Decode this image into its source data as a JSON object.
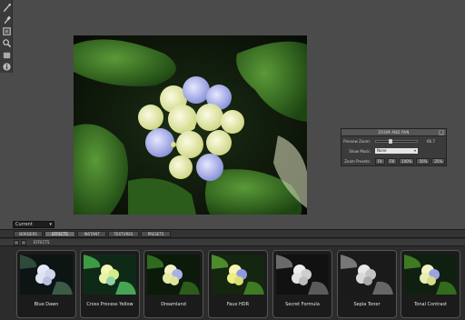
{
  "toolbar": {
    "tools": [
      {
        "name": "brush-icon"
      },
      {
        "name": "eyedropper-icon"
      },
      {
        "name": "layer-icon"
      },
      {
        "name": "zoom-icon"
      },
      {
        "name": "hand-icon"
      },
      {
        "name": "info-icon"
      }
    ]
  },
  "zoom_panel": {
    "title": "ZOOM AND PAN",
    "close_label": "x",
    "preview_zoom_label": "Preview Zoom:",
    "preview_zoom_value": "66.7",
    "show_mask_label": "Show Mask:",
    "show_mask_value": "None",
    "zoom_presets_label": "Zoom Presets:",
    "zoom_presets": [
      "Fit",
      "Fill",
      "100%",
      "50%",
      "25%"
    ]
  },
  "view_select": {
    "value": "Current"
  },
  "tabs": [
    {
      "label": "BORDERS",
      "active": false
    },
    {
      "label": "EFFECTS",
      "active": true
    },
    {
      "label": "INSTANT",
      "active": false
    },
    {
      "label": "TEXTURES",
      "active": false
    },
    {
      "label": "PRESETS",
      "active": false
    }
  ],
  "subbar": {
    "prev": "‹",
    "next": "›",
    "label": "EFFECTS"
  },
  "presets": [
    {
      "label": "Blue Dawn",
      "tone": "blue"
    },
    {
      "label": "Cross Process Yellow",
      "tone": "cross"
    },
    {
      "label": "Dreamland",
      "tone": "dream"
    },
    {
      "label": "Faux HDR",
      "tone": "hdr"
    },
    {
      "label": "Secret Formula",
      "tone": "secret"
    },
    {
      "label": "Sepia Toner",
      "tone": "sepia"
    },
    {
      "label": "Tonal Contrast",
      "tone": "tonal"
    }
  ],
  "colors": {
    "panel_bg": "#4b4b4b",
    "bottom_bg": "#2c2c2c",
    "leaf": "#2f6a1f",
    "petal_blue": "#9aa4e0",
    "petal_yellow": "#e8ecb0"
  }
}
